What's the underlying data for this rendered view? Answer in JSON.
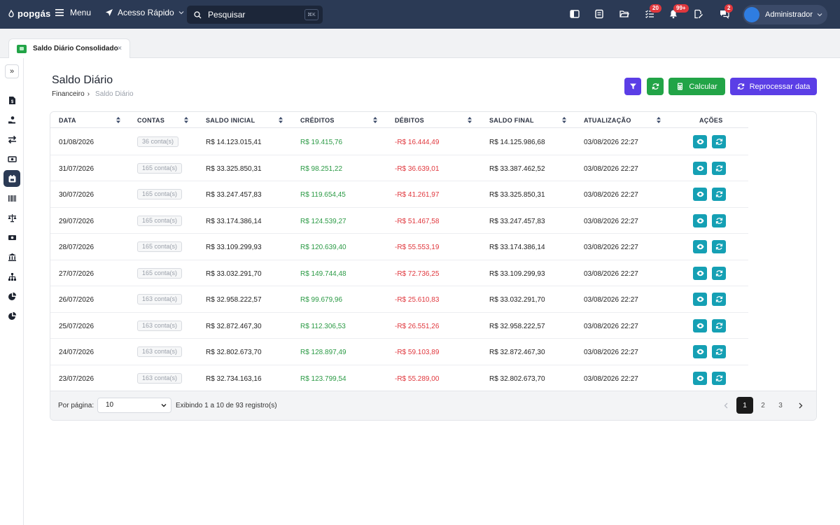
{
  "topbar": {
    "logo_text": "popgás",
    "menu_label": "Menu",
    "quick_access_label": "Acesso Rápido",
    "search_placeholder": "Pesquisar",
    "search_shortcut": "⌘K",
    "tasks_badge": "20",
    "notifications_badge": "99+",
    "messages_badge": "2",
    "user_name": "Administrador"
  },
  "tabs": [
    {
      "label": "Saldo Diário Consolidado",
      "close": "×"
    }
  ],
  "sidebar": {
    "icons": [
      "file-dollar-icon",
      "hand-coin-icon",
      "transfer-arrows-icon",
      "money-exchange-icon",
      "calendar-icon",
      "barcode-icon",
      "scale-icon",
      "cash-icon",
      "bank-icon",
      "hierarchy-icon",
      "pie-chart-icon",
      "pie-chart-alt-icon"
    ],
    "active_index": 4
  },
  "page": {
    "title": "Saldo Diário",
    "breadcrumb_parent": "Financeiro",
    "breadcrumb_separator": "›",
    "breadcrumb_current": "Saldo Diário"
  },
  "actions": {
    "calculate_label": "Calcular",
    "reprocess_label": "Reprocessar data"
  },
  "table": {
    "columns": [
      "DATA",
      "CONTAS",
      "SALDO INICIAL",
      "CRÉDITOS",
      "DÉBITOS",
      "SALDO FINAL",
      "ATUALIZAÇÃO",
      "AÇÕES"
    ],
    "rows": [
      {
        "data": "01/08/2026",
        "contas": "36 conta(s)",
        "saldo_inicial": "R$ 14.123.015,41",
        "creditos": "R$ 19.415,76",
        "debitos": "-R$ 16.444,49",
        "saldo_final": "R$ 14.125.986,68",
        "atualizacao": "03/08/2026 22:27"
      },
      {
        "data": "31/07/2026",
        "contas": "165 conta(s)",
        "saldo_inicial": "R$ 33.325.850,31",
        "creditos": "R$ 98.251,22",
        "debitos": "-R$ 36.639,01",
        "saldo_final": "R$ 33.387.462,52",
        "atualizacao": "03/08/2026 22:27"
      },
      {
        "data": "30/07/2026",
        "contas": "165 conta(s)",
        "saldo_inicial": "R$ 33.247.457,83",
        "creditos": "R$ 119.654,45",
        "debitos": "-R$ 41.261,97",
        "saldo_final": "R$ 33.325.850,31",
        "atualizacao": "03/08/2026 22:27"
      },
      {
        "data": "29/07/2026",
        "contas": "165 conta(s)",
        "saldo_inicial": "R$ 33.174.386,14",
        "creditos": "R$ 124.539,27",
        "debitos": "-R$ 51.467,58",
        "saldo_final": "R$ 33.247.457,83",
        "atualizacao": "03/08/2026 22:27"
      },
      {
        "data": "28/07/2026",
        "contas": "165 conta(s)",
        "saldo_inicial": "R$ 33.109.299,93",
        "creditos": "R$ 120.639,40",
        "debitos": "-R$ 55.553,19",
        "saldo_final": "R$ 33.174.386,14",
        "atualizacao": "03/08/2026 22:27"
      },
      {
        "data": "27/07/2026",
        "contas": "165 conta(s)",
        "saldo_inicial": "R$ 33.032.291,70",
        "creditos": "R$ 149.744,48",
        "debitos": "-R$ 72.736,25",
        "saldo_final": "R$ 33.109.299,93",
        "atualizacao": "03/08/2026 22:27"
      },
      {
        "data": "26/07/2026",
        "contas": "163 conta(s)",
        "saldo_inicial": "R$ 32.958.222,57",
        "creditos": "R$ 99.679,96",
        "debitos": "-R$ 25.610,83",
        "saldo_final": "R$ 33.032.291,70",
        "atualizacao": "03/08/2026 22:27"
      },
      {
        "data": "25/07/2026",
        "contas": "163 conta(s)",
        "saldo_inicial": "R$ 32.872.467,30",
        "creditos": "R$ 112.306,53",
        "debitos": "-R$ 26.551,26",
        "saldo_final": "R$ 32.958.222,57",
        "atualizacao": "03/08/2026 22:27"
      },
      {
        "data": "24/07/2026",
        "contas": "163 conta(s)",
        "saldo_inicial": "R$ 32.802.673,70",
        "creditos": "R$ 128.897,49",
        "debitos": "-R$ 59.103,89",
        "saldo_final": "R$ 32.872.467,30",
        "atualizacao": "03/08/2026 22:27"
      },
      {
        "data": "23/07/2026",
        "contas": "163 conta(s)",
        "saldo_inicial": "R$ 32.734.163,16",
        "creditos": "R$ 123.799,54",
        "debitos": "-R$ 55.289,00",
        "saldo_final": "R$ 32.802.673,70",
        "atualizacao": "03/08/2026 22:27"
      }
    ]
  },
  "footer": {
    "per_page_label": "Por página:",
    "per_page_value": "10",
    "records_text": "Exibindo 1 a 10 de 93 registro(s)",
    "pages": [
      "1",
      "2",
      "3"
    ],
    "current_page": "1"
  },
  "colors": {
    "topbar": "#2b3a55",
    "primary_purple": "#5b3ee6",
    "success_green": "#22a447",
    "action_teal": "#15a0b4",
    "credit_green": "#2b9a45",
    "debit_red": "#e0373d"
  }
}
